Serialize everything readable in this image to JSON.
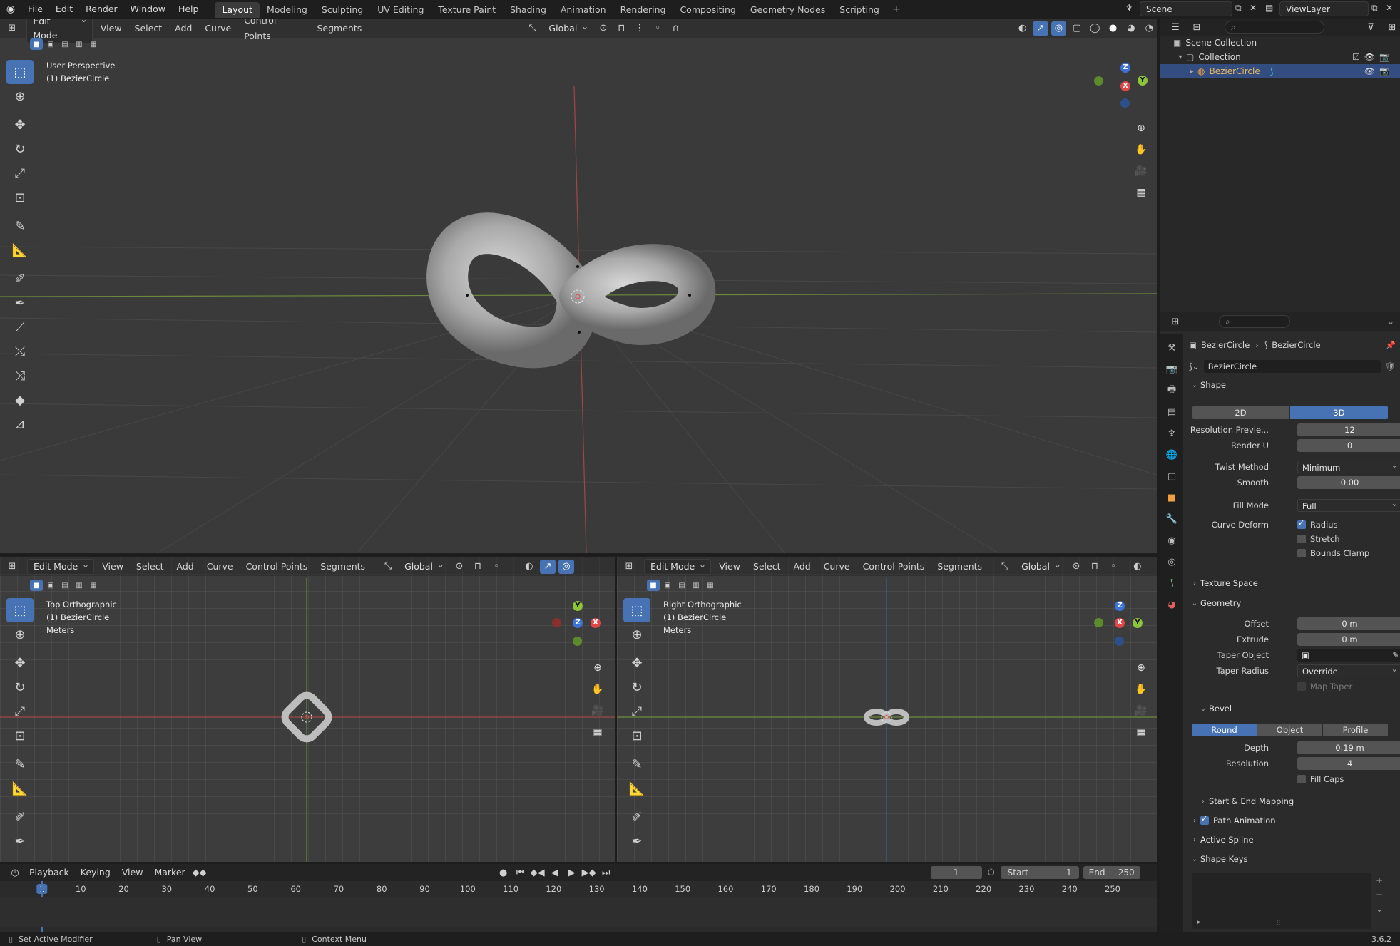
{
  "topbar": {
    "menus": [
      "File",
      "Edit",
      "Render",
      "Window",
      "Help"
    ],
    "workspaces": [
      "Layout",
      "Modeling",
      "Sculpting",
      "UV Editing",
      "Texture Paint",
      "Shading",
      "Animation",
      "Rendering",
      "Compositing",
      "Geometry Nodes",
      "Scripting"
    ],
    "active_workspace": "Layout",
    "scene": "Scene",
    "view_layer": "ViewLayer"
  },
  "main_viewport": {
    "mode": "Edit Mode",
    "menus": [
      "View",
      "Select",
      "Add",
      "Curve",
      "Control Points",
      "Segments"
    ],
    "orientation": "Global",
    "view_name": "User Perspective",
    "object_label": "(1) BezierCircle"
  },
  "top_viewport": {
    "mode": "Edit Mode",
    "menus": [
      "View",
      "Select",
      "Add",
      "Curve",
      "Control Points",
      "Segments"
    ],
    "orientation": "Global",
    "view_name": "Top Orthographic",
    "object_label": "(1) BezierCircle",
    "units": "Meters"
  },
  "right_viewport": {
    "mode": "Edit Mode",
    "menus": [
      "View",
      "Select",
      "Add",
      "Curve",
      "Control Points",
      "Segments"
    ],
    "orientation": "Global",
    "view_name": "Right Orthographic",
    "object_label": "(1) BezierCircle",
    "units": "Meters"
  },
  "gizmo": {
    "x": "X",
    "y": "Y",
    "z": "Z"
  },
  "outliner": {
    "scene_collection": "Scene Collection",
    "collection": "Collection",
    "object": "BezierCircle"
  },
  "properties": {
    "breadcrumb_object": "BezierCircle",
    "breadcrumb_data": "BezierCircle",
    "datablock_name": "BezierCircle",
    "shape": {
      "title": "Shape",
      "dims_2d": "2D",
      "dims_3d": "3D",
      "resolution_preview_label": "Resolution Previe...",
      "resolution_preview": "12",
      "render_u_label": "Render U",
      "render_u": "0",
      "twist_method_label": "Twist Method",
      "twist_method": "Minimum",
      "smooth_label": "Smooth",
      "smooth": "0.00",
      "fill_mode_label": "Fill Mode",
      "fill_mode": "Full",
      "curve_deform_label": "Curve Deform",
      "radius_label": "Radius",
      "stretch_label": "Stretch",
      "bounds_clamp_label": "Bounds Clamp"
    },
    "texture_space_title": "Texture Space",
    "geometry": {
      "title": "Geometry",
      "offset_label": "Offset",
      "offset": "0 m",
      "extrude_label": "Extrude",
      "extrude": "0 m",
      "taper_object_label": "Taper Object",
      "taper_radius_label": "Taper Radius",
      "taper_radius": "Override",
      "map_taper_label": "Map Taper"
    },
    "bevel": {
      "title": "Bevel",
      "mode_round": "Round",
      "mode_object": "Object",
      "mode_profile": "Profile",
      "depth_label": "Depth",
      "depth": "0.19 m",
      "resolution_label": "Resolution",
      "resolution": "4",
      "fill_caps_label": "Fill Caps"
    },
    "start_end_mapping_title": "Start & End Mapping",
    "path_animation_title": "Path Animation",
    "active_spline_title": "Active Spline",
    "shape_keys_title": "Shape Keys"
  },
  "timeline": {
    "menus": [
      "Playback",
      "Keying",
      "View",
      "Marker"
    ],
    "current_frame": "1",
    "start_label": "Start",
    "start": "1",
    "end_label": "End",
    "end": "250",
    "ticks": [
      "1",
      "10",
      "20",
      "30",
      "40",
      "50",
      "60",
      "70",
      "80",
      "90",
      "100",
      "110",
      "120",
      "130",
      "140",
      "150",
      "160",
      "170",
      "180",
      "190",
      "200",
      "210",
      "220",
      "230",
      "240",
      "250"
    ]
  },
  "statusbar": {
    "left": "Set Active Modifier",
    "middle": "Pan View",
    "right": "Context Menu",
    "version": "3.6.2"
  }
}
